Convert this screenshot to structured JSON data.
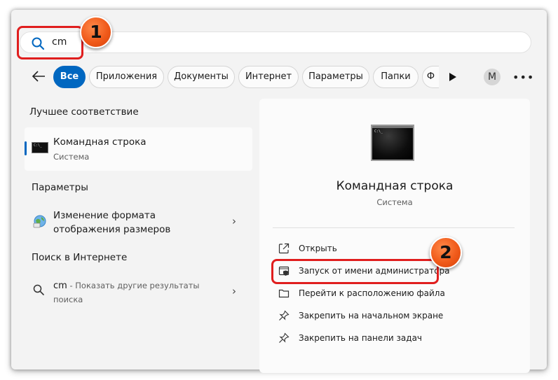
{
  "search": {
    "query": "cm"
  },
  "annotations": {
    "badge1": "1",
    "badge2": "2"
  },
  "filters": [
    {
      "label": "Все"
    },
    {
      "label": "Приложения"
    },
    {
      "label": "Документы"
    },
    {
      "label": "Интернет"
    },
    {
      "label": "Параметры"
    },
    {
      "label": "Папки"
    },
    {
      "label": "Ф"
    }
  ],
  "account": {
    "initial": "M"
  },
  "more_label": "•••",
  "best_match": {
    "heading": "Лучшее соответствие",
    "title": "Командная строка",
    "subtitle": "Система"
  },
  "settings": {
    "heading": "Параметры",
    "item_line1": "Изменение формата",
    "item_line2": "отображения размеров"
  },
  "web": {
    "heading": "Поиск в Интернете",
    "query": "cm",
    "desc_line1": " - Показать другие результаты",
    "desc_line2": "поиска"
  },
  "details": {
    "title": "Командная строка",
    "subtitle": "Система",
    "actions": [
      {
        "label": "Открыть",
        "icon": "open-icon"
      },
      {
        "label": "Запуск от имени администратора",
        "icon": "shield-icon"
      },
      {
        "label": "Перейти к расположению файла",
        "icon": "folder-icon"
      },
      {
        "label": "Закрепить на начальном экране",
        "icon": "pin-icon"
      },
      {
        "label": "Закрепить на панели задач",
        "icon": "pin-icon"
      }
    ]
  },
  "colors": {
    "accent": "#0067c0",
    "highlight": "#e01e1e",
    "badge": "#f05a1a"
  }
}
